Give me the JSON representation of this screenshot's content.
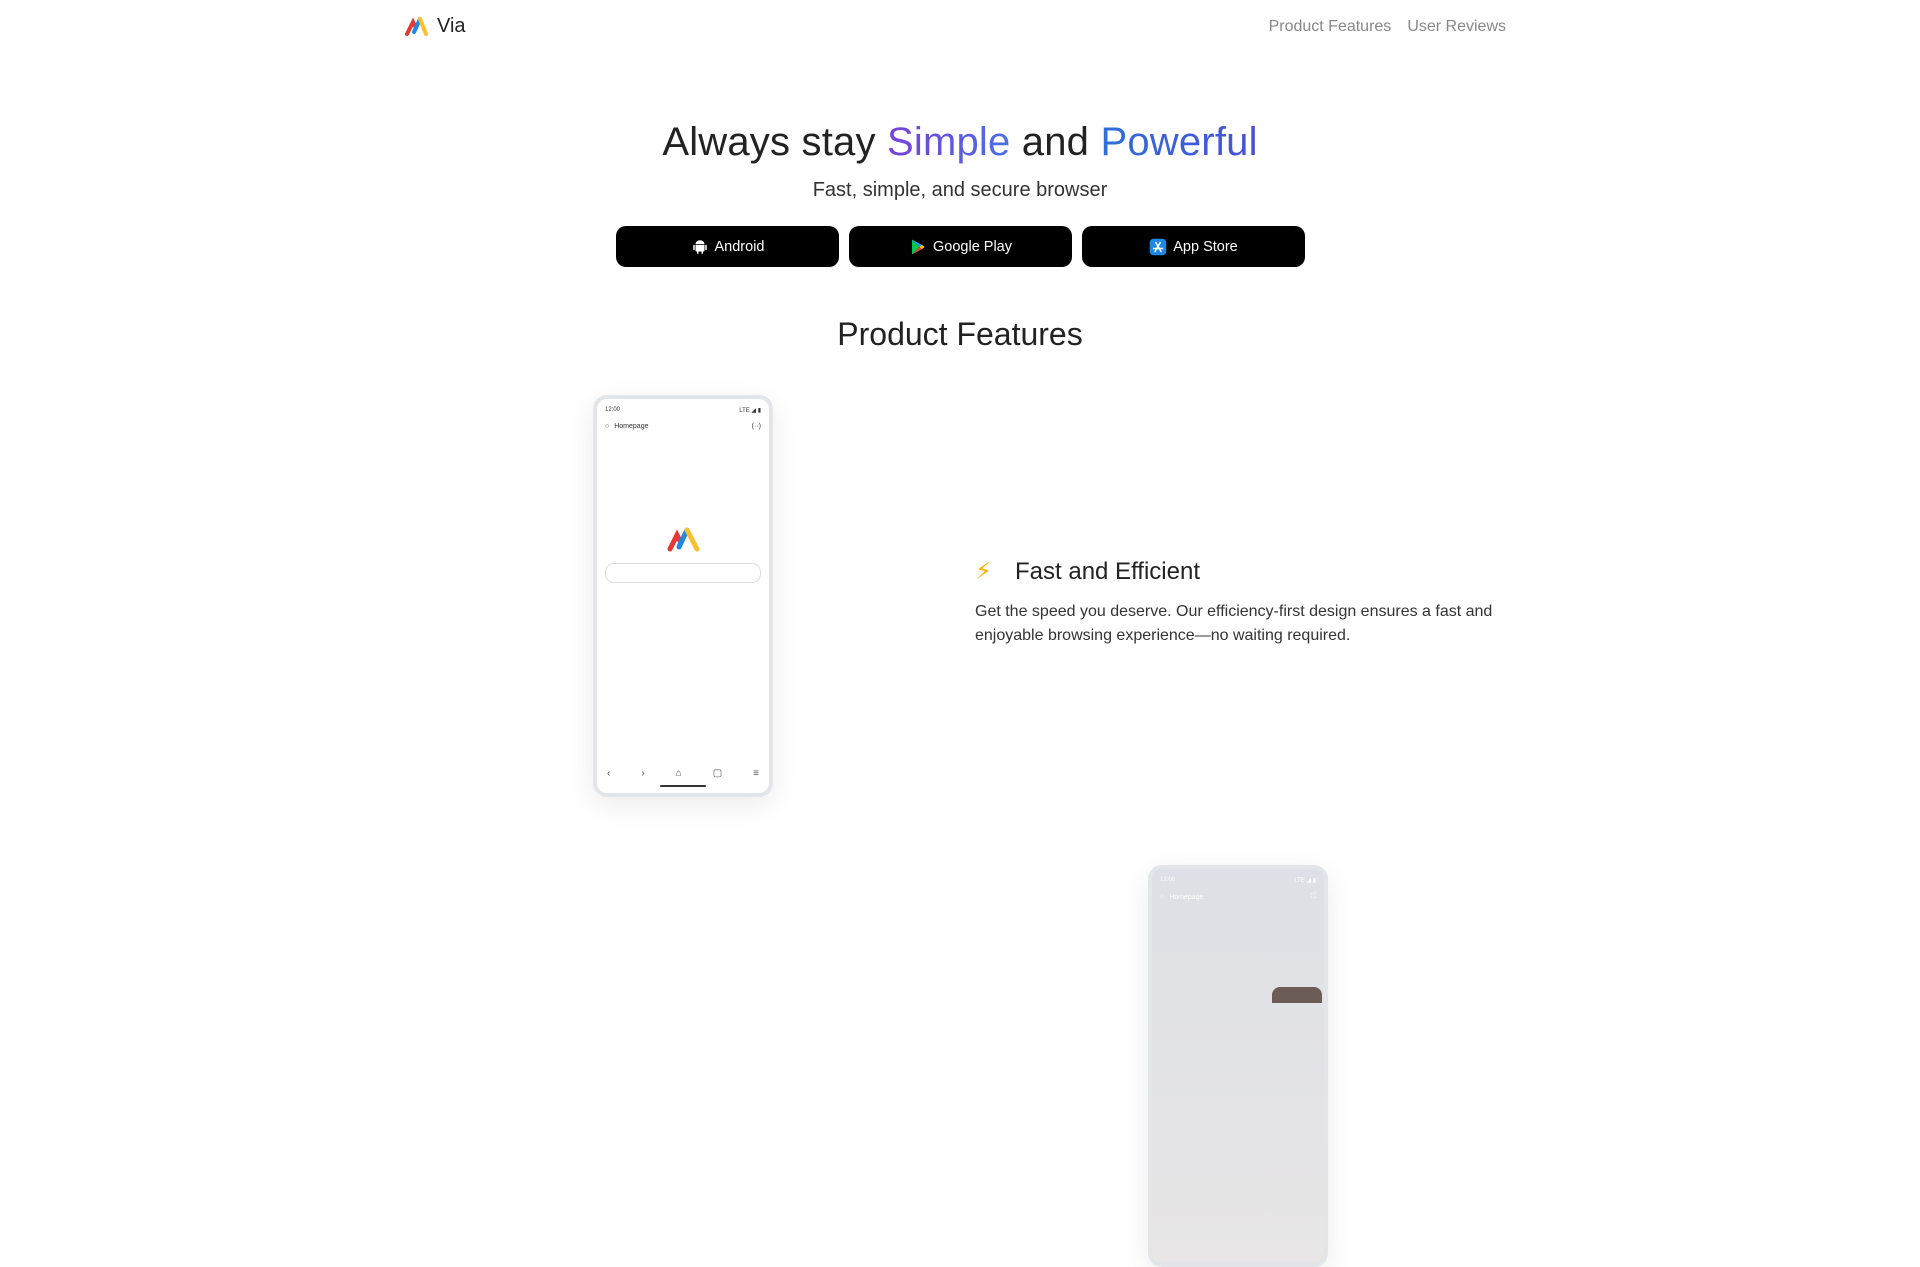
{
  "brand": {
    "name": "Via",
    "logo_icon": "via-logo-icon"
  },
  "nav": {
    "items": [
      "Product Features",
      "User Reviews"
    ]
  },
  "hero": {
    "title_prefix": "Always stay ",
    "title_simple": "Simple",
    "title_and": " and ",
    "title_powerful": "Powerful",
    "subtitle": "Fast, simple, and secure browser"
  },
  "downloads": [
    {
      "label": "Android",
      "icon": "android-icon"
    },
    {
      "label": "Google Play",
      "icon": "google-play-icon"
    },
    {
      "label": "App Store",
      "icon": "app-store-icon"
    }
  ],
  "features_title": "Product Features",
  "phone": {
    "time": "12:00",
    "signal": "LTE ◢ ▮",
    "search_label": "Homepage",
    "qr": "(··)",
    "bottom_icons": [
      "back-icon",
      "forward-icon",
      "home-icon",
      "tabs-icon",
      "menu-icon"
    ]
  },
  "feature": {
    "icon": "lightning-icon",
    "title": "Fast and Efficient",
    "description": "Get the speed you deserve. Our efficiency-first design ensures a fast and enjoyable browsing experience—no waiting required."
  },
  "colors": {
    "simple": "#7a3fdc",
    "powerful": "#2f6fd8",
    "button_bg": "#000000",
    "nav_text": "#888888"
  }
}
